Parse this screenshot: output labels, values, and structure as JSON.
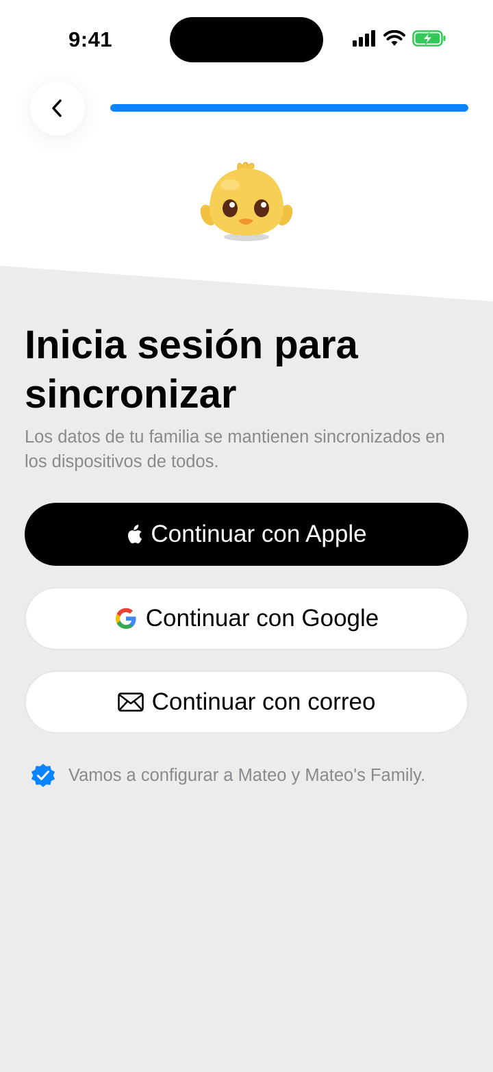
{
  "status_bar": {
    "time": "9:41",
    "icons": [
      "signal-icon",
      "wifi-icon",
      "battery-charging-icon"
    ]
  },
  "header": {
    "back_icon": "chevron-left-icon",
    "progress_fraction": 1.0
  },
  "mascot": {
    "icon": "chick-icon"
  },
  "content": {
    "title": "Inicia sesión para sincronizar",
    "subtitle": "Los datos de tu familia se mantienen sincronizados en los dispositivos de todos."
  },
  "buttons": {
    "apple_label": "Continuar con Apple",
    "google_label": "Continuar con Google",
    "email_label": "Continuar con correo"
  },
  "note": {
    "text": "Vamos a configurar a Mateo y Mateo's Family."
  },
  "colors": {
    "accent": "#0a84ff",
    "background_gray": "#ececec",
    "apple_button": "#000000",
    "battery_green": "#34c759",
    "muted_text": "#8a8a8e"
  }
}
